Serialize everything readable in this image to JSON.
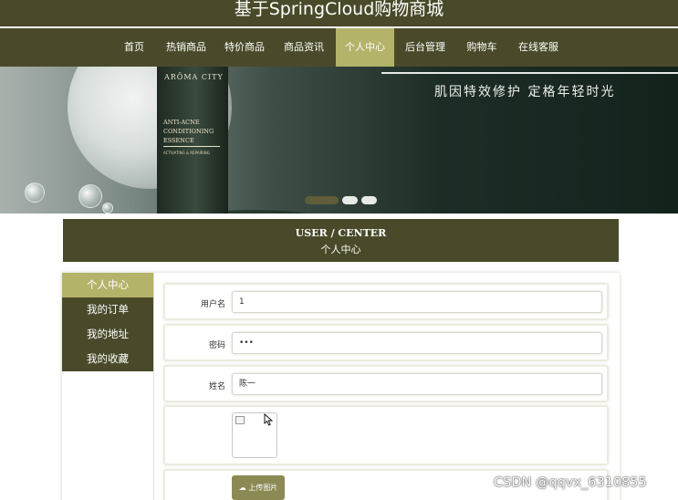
{
  "site": {
    "title": "基于SpringCloud购物商城"
  },
  "nav": {
    "items": [
      {
        "label": "首页"
      },
      {
        "label": "热销商品"
      },
      {
        "label": "特价商品"
      },
      {
        "label": "商品资讯"
      },
      {
        "label": "个人中心",
        "active": true
      },
      {
        "label": "后台管理"
      },
      {
        "label": "购物车"
      },
      {
        "label": "在线客服"
      }
    ]
  },
  "banner": {
    "brand": "ARŌMA CITY",
    "product_name": "ANTI-ACNE CONDITIONING ESSENCE",
    "product_sub": "ACTIVATING & REPAIRING",
    "slogan": "肌因特效修护  定格年轻时光",
    "slide_count": 3,
    "active_slide": 0
  },
  "user_center": {
    "title_en": "USER / CENTER",
    "title_cn": "个人中心"
  },
  "side_menu": {
    "items": [
      {
        "label": "个人中心",
        "active": true
      },
      {
        "label": "我的订单"
      },
      {
        "label": "我的地址"
      },
      {
        "label": "我的收藏"
      }
    ]
  },
  "form": {
    "username": {
      "label": "用户名",
      "value": "1"
    },
    "password": {
      "label": "密码",
      "value": "•••"
    },
    "name": {
      "label": "姓名",
      "value": "陈一"
    },
    "upload": {
      "label": "上传图片"
    }
  },
  "colors": {
    "primary": "#4a4a2a",
    "active": "#b4b36a",
    "button": "#8b8a55"
  },
  "watermark": "CSDN @qqvx_6310855"
}
